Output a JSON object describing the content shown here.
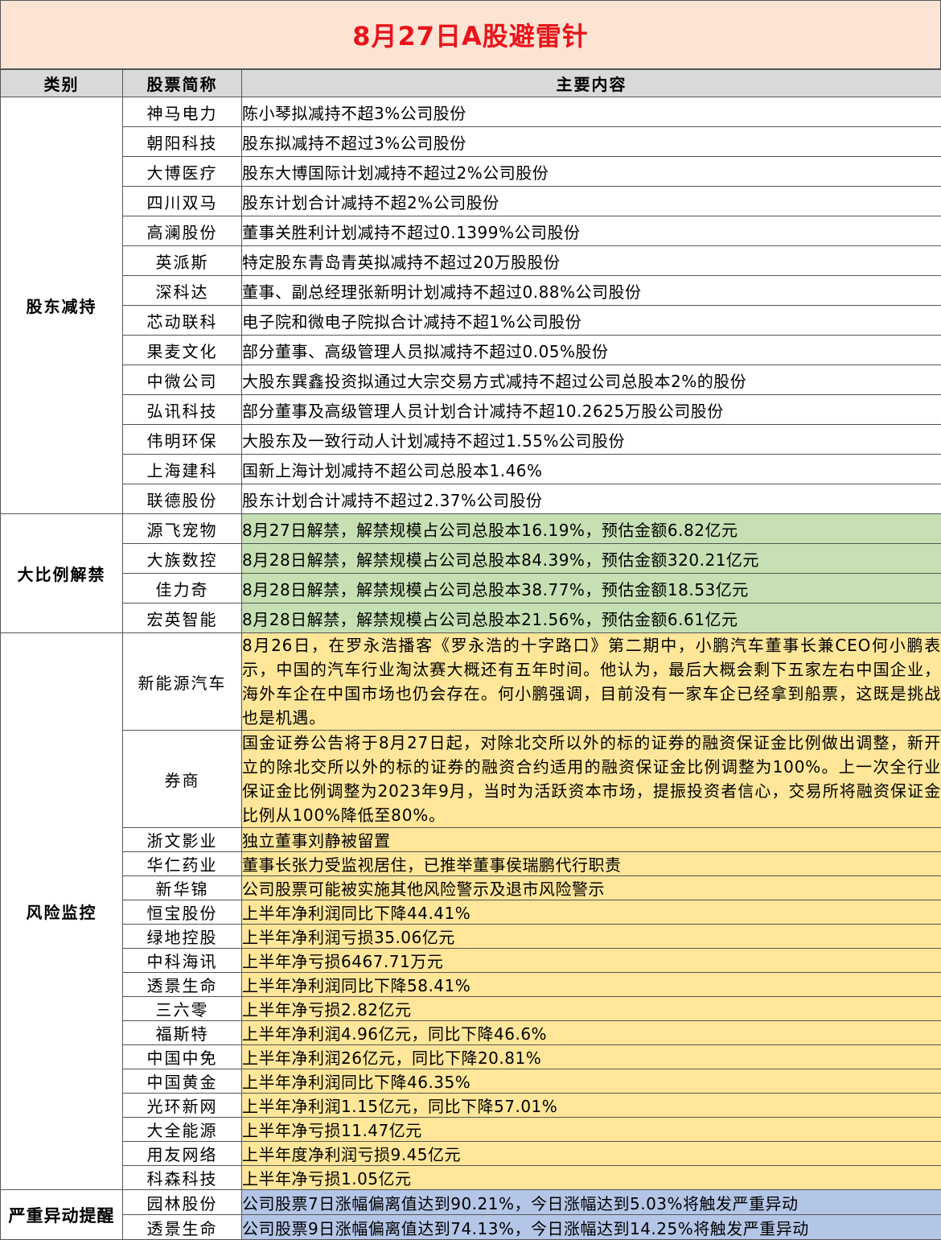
{
  "title": "8月27日A股避雷针",
  "headers": {
    "category": "类别",
    "stock": "股票简称",
    "content": "主要内容"
  },
  "groups": [
    {
      "category": "股东减持",
      "rows": [
        {
          "name": "神马电力",
          "text": "陈小琴拟减持不超3%公司股份"
        },
        {
          "name": "朝阳科技",
          "text": "股东拟减持不超过3%公司股份"
        },
        {
          "name": "大博医疗",
          "text": "股东大博国际计划减持不超过2%公司股份"
        },
        {
          "name": "四川双马",
          "text": "股东计划合计减持不超2%公司股份"
        },
        {
          "name": "高澜股份",
          "text": "董事关胜利计划减持不超过0.1399%公司股份"
        },
        {
          "name": "英派斯",
          "text": "特定股东青岛青英拟减持不超过20万股股份"
        },
        {
          "name": "深科达",
          "text": "董事、副总经理张新明计划减持不超过0.88%公司股份"
        },
        {
          "name": "芯动联科",
          "text": "电子院和微电子院拟合计减持不超1%公司股份"
        },
        {
          "name": "果麦文化",
          "text": "部分董事、高级管理人员拟减持不超过0.05%股份"
        },
        {
          "name": "中微公司",
          "text": "大股东巽鑫投资拟通过大宗交易方式减持不超过公司总股本2%的股份"
        },
        {
          "name": "弘讯科技",
          "text": "部分董事及高级管理人员计划合计减持不超10.2625万股公司股份"
        },
        {
          "name": "伟明环保",
          "text": "大股东及一致行动人计划减持不超过1.55%公司股份"
        },
        {
          "name": "上海建科",
          "text": "国新上海计划减持不超公司总股本1.46%"
        },
        {
          "name": "联德股份",
          "text": "股东计划合计减持不超过2.37%公司股份"
        }
      ]
    },
    {
      "category": "大比例解禁",
      "rows": [
        {
          "name": "源飞宠物",
          "text": "8月27日解禁，解禁规模占公司总股本16.19%，预估金额6.82亿元"
        },
        {
          "name": "大族数控",
          "text": "8月28日解禁，解禁规模占公司总股本84.39%，预估金额320.21亿元"
        },
        {
          "name": "佳力奇",
          "text": "8月28日解禁，解禁规模占公司总股本38.77%，预估金额18.53亿元"
        },
        {
          "name": "宏英智能",
          "text": "8月28日解禁，解禁规模占公司总股本21.56%，预估金额6.61亿元"
        }
      ]
    },
    {
      "category": "风险监控",
      "rows": [
        {
          "name": "新能源汽车",
          "text": "8月26日，在罗永浩播客《罗永浩的十字路口》第二期中，小鹏汽车董事长兼CEO何小鹏表示，中国的汽车行业淘汰赛大概还有五年时间。他认为，最后大概会剩下五家左右中国企业，海外车企在中国市场也仍会存在。何小鹏强调，目前没有一家车企已经拿到船票，这既是挑战也是机遇。"
        },
        {
          "name": "券商",
          "text": "国金证券公告将于8月27日起，对除北交所以外的标的证券的融资保证金比例做出调整，新开立的除北交所以外的标的证券的融资合约适用的融资保证金比例调整为100%。上一次全行业保证金比例调整为2023年9月，当时为活跃资本市场，提振投资者信心，交易所将融资保证金比例从100%降低至80%。"
        },
        {
          "name": "浙文影业",
          "text": "独立董事刘静被留置"
        },
        {
          "name": "华仁药业",
          "text": "董事长张力受监视居住，已推举董事侯瑞鹏代行职责"
        },
        {
          "name": "新华锦",
          "text": "公司股票可能被实施其他风险警示及退市风险警示"
        },
        {
          "name": "恒宝股份",
          "text": "上半年净利润同比下降44.41%"
        },
        {
          "name": "绿地控股",
          "text": "上半年净利润亏损35.06亿元"
        },
        {
          "name": "中科海讯",
          "text": "上半年净亏损6467.71万元"
        },
        {
          "name": "透景生命",
          "text": "上半年净利润同比下降58.41%"
        },
        {
          "name": "三六零",
          "text": "上半年净亏损2.82亿元"
        },
        {
          "name": "福斯特",
          "text": "上半年净利润4.96亿元，同比下降46.6%"
        },
        {
          "name": "中国中免",
          "text": "上半年净利润26亿元，同比下降20.81%"
        },
        {
          "name": "中国黄金",
          "text": "上半年净利润同比下降46.35%"
        },
        {
          "name": "光环新网",
          "text": "上半年净利润1.15亿元，同比下降57.01%"
        },
        {
          "name": "大全能源",
          "text": "上半年净亏损11.47亿元"
        },
        {
          "name": "用友网络",
          "text": "上半年度净利润亏损9.45亿元"
        },
        {
          "name": "科森科技",
          "text": "上半年净亏损1.05亿元"
        }
      ]
    },
    {
      "category": "严重异动提醒",
      "rows": [
        {
          "name": "园林股份",
          "text": "公司股票7日涨幅偏离值达到90.21%，今日涨幅达到5.03%将触发严重异动"
        },
        {
          "name": "透景生命",
          "text": "公司股票9日涨幅偏离值达到74.13%，今日涨幅达到14.25%将触发严重异动"
        }
      ]
    }
  ]
}
